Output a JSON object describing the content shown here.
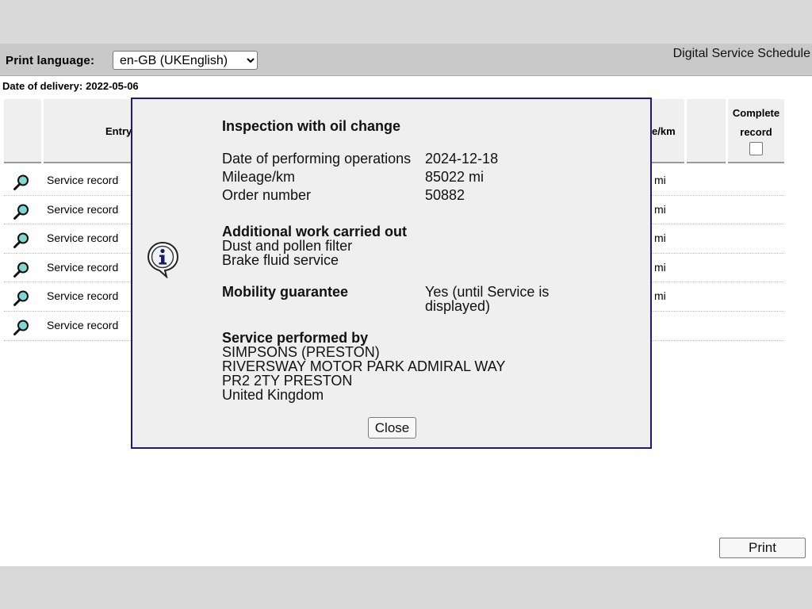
{
  "header": {
    "print_language_label": "Print language:",
    "language_selected": "en-GB (UKEnglish)",
    "app_title": "Digital Service Schedule"
  },
  "delivery": {
    "label": "Date of delivery:",
    "value": "2022-05-06"
  },
  "table": {
    "columns": {
      "entry": "Entry",
      "mileage": "e/km",
      "complete_line1": "Complete",
      "complete_line2": "record"
    },
    "rows": [
      {
        "label": "Service record",
        "mileage": "mi"
      },
      {
        "label": "Service record",
        "mileage": "mi"
      },
      {
        "label": "Service record",
        "mileage": "mi"
      },
      {
        "label": "Service record",
        "mileage": "mi"
      },
      {
        "label": "Service record",
        "mileage": "mi"
      },
      {
        "label": "Service record",
        "mileage": ""
      }
    ]
  },
  "modal": {
    "title": "Inspection with oil change",
    "date_label": "Date of performing operations",
    "date_value": "2024-12-18",
    "mileage_label": "Mileage/km",
    "mileage_value": "85022 mi",
    "order_label": "Order number",
    "order_value": "50882",
    "additional_heading": "Additional work carried out",
    "additional_items": [
      "Dust and pollen filter",
      "Brake fluid service"
    ],
    "mobility_label": "Mobility guarantee",
    "mobility_value_line1": "Yes (until Service is",
    "mobility_value_line2": "displayed)",
    "performed_heading": "Service performed by",
    "performed_lines": [
      "SIMPSONS (PRESTON)",
      "RIVERSWAY MOTOR PARK ADMIRAL WAY",
      "PR2 2TY PRESTON",
      "United Kingdom"
    ],
    "close_label": "Close"
  },
  "footer": {
    "print_label": "Print"
  },
  "icons": {
    "row_icon": "magnifier-icon",
    "modal_icon": "info-icon"
  },
  "colors": {
    "modal_border": "#1c1c78",
    "magnifier_lens": "#7fd8d2"
  }
}
